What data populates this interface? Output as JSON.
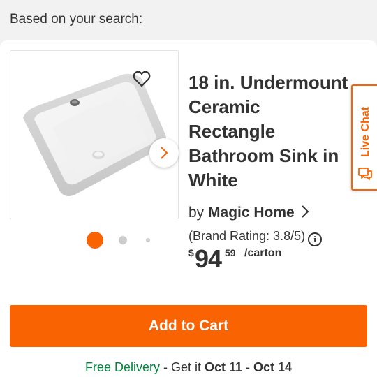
{
  "header": {
    "title": "Based on your search:"
  },
  "product": {
    "title": "18 in. Undermount\nCeramic\nRectangle\nBathroom Sink in\nWhite",
    "by_label": "by",
    "brand": "Magic Home",
    "brand_rating": "(Brand Rating: 3.8/5)",
    "info_glyph": "i",
    "price": {
      "currency": "$",
      "dollars": "94",
      "cents": "59",
      "unit": "/carton"
    }
  },
  "gallery": {
    "image_count": 3,
    "active_index": 0
  },
  "live_chat": {
    "label": "Live Chat"
  },
  "actions": {
    "add_to_cart": "Add to Cart"
  },
  "delivery": {
    "free": "Free Delivery",
    "sep": " - Get it ",
    "date_start": "Oct 11",
    "dash": " - ",
    "date_end": "Oct 14"
  },
  "colors": {
    "brand_orange": "#f96302",
    "delivery_green": "#00853e"
  },
  "icons": [
    "heart-icon",
    "chevron-right-icon",
    "info-icon",
    "chat-icon"
  ]
}
